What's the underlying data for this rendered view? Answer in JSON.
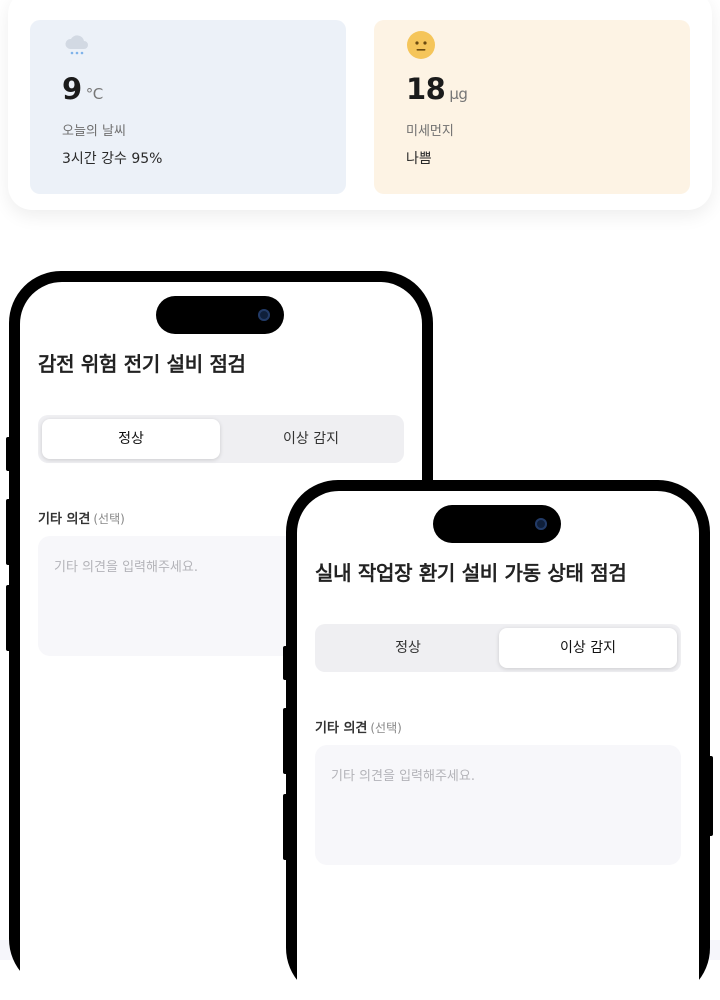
{
  "weather": {
    "icon": "rain-cloud-icon",
    "temperature": "9",
    "unit": "°C",
    "label": "오늘의 날씨",
    "precipitation": "3시간 강수 95%"
  },
  "dust": {
    "icon": "neutral-face-icon",
    "value": "18",
    "unit": "μg",
    "label": "미세먼지",
    "status": "나쁨"
  },
  "phone_a": {
    "title": "감전 위험 전기 설비 점검",
    "options": [
      "정상",
      "이상 감지"
    ],
    "selected_option": "정상",
    "comment_label": "기타 의견",
    "comment_optional": "(선택)",
    "comment_placeholder": "기타 의견을 입력해주세요.",
    "comment_value": ""
  },
  "phone_b": {
    "title": "실내 작업장 환기 설비 가동 상태 점검",
    "options": [
      "정상",
      "이상 감지"
    ],
    "selected_option": "이상 감지",
    "comment_label": "기타 의견",
    "comment_optional": "(선택)",
    "comment_placeholder": "기타 의견을 입력해주세요.",
    "comment_value": ""
  },
  "colors": {
    "weather_tile": "#ecf1f8",
    "dust_tile": "#fdf3e4",
    "dust_face": "#f5c55a",
    "rain_drops": "#7fb3ea"
  }
}
